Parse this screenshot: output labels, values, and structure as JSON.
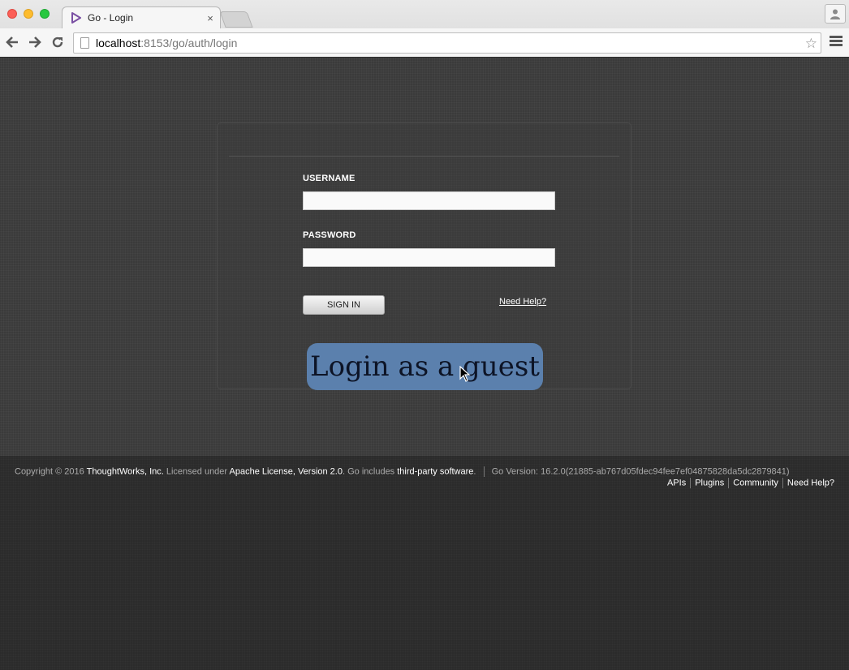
{
  "browser": {
    "tab_title": "Go - Login",
    "tab_close": "×",
    "url_host": "localhost",
    "url_rest": ":8153/go/auth/login"
  },
  "login": {
    "username_label": "USERNAME",
    "username_value": "",
    "password_label": "PASSWORD",
    "password_value": "",
    "signin_label": "SIGN IN",
    "need_help_label": "Need Help?",
    "guest_label": "Login as a guest"
  },
  "footer": {
    "copyright": "Copyright © 2016",
    "company": "ThoughtWorks, Inc.",
    "licensed_under": "Licensed under",
    "license": "Apache License, Version 2.0",
    "go_includes": ". Go includes",
    "third_party": "third-party software",
    "period": ".",
    "version": "Go Version: 16.2.0(21885-ab767d05fdec94fee7ef04875828da5dc2879841)",
    "links": [
      "APIs",
      "Plugins",
      "Community",
      "Need Help?"
    ]
  },
  "colors": {
    "guest_button": "#5b80ad",
    "page_bg": "#3b3b3b",
    "footer_bg": "#2b2b2b",
    "favicon": "#7a4fa3"
  },
  "icons": {
    "back": "back-arrow-icon",
    "forward": "forward-arrow-icon",
    "reload": "reload-icon",
    "bookmark": "star-icon",
    "menu": "hamburger-menu-icon",
    "profile": "profile-icon",
    "favicon": "go-logo-icon"
  }
}
